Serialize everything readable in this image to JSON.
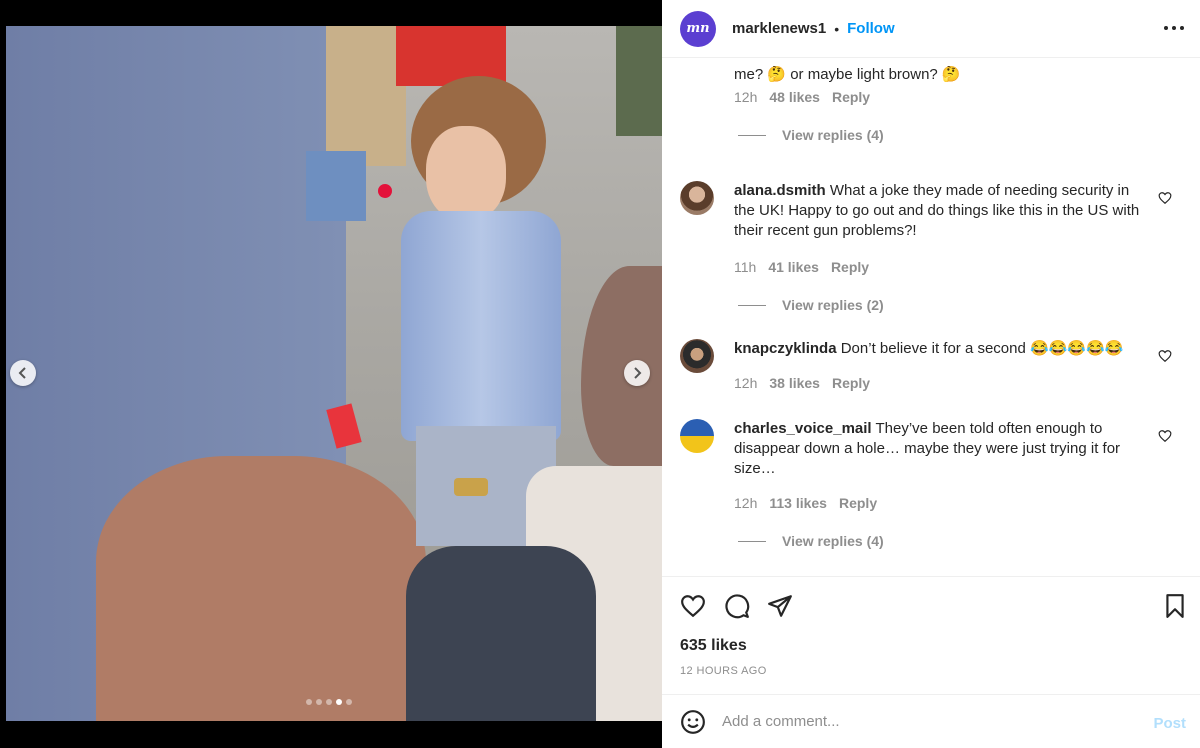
{
  "post": {
    "username": "marklenews1",
    "avatar_text": "mn",
    "follow_label": "Follow",
    "separator": "•"
  },
  "comments": [
    {
      "username": "",
      "text": "me? 🤔 or maybe light brown? 🤔",
      "time": "12h",
      "likes": "48 likes",
      "reply": "Reply",
      "view_replies": "View replies (4)"
    },
    {
      "username": "alana.dsmith",
      "text": "What a joke they made of needing security in the UK! Happy to go out and do things like this in the US with their recent gun problems?!",
      "time": "11h",
      "likes": "41 likes",
      "reply": "Reply",
      "view_replies": "View replies (2)"
    },
    {
      "username": "knapczyklinda",
      "text": "Don’t believe it for a second 😂😂😂😂😂",
      "time": "12h",
      "likes": "38 likes",
      "reply": "Reply"
    },
    {
      "username": "charles_voice_mail",
      "text": "They’ve been told often enough to disappear down a hole… maybe they were just trying it for size…",
      "time": "12h",
      "likes": "113 likes",
      "reply": "Reply",
      "view_replies": "View replies (4)"
    }
  ],
  "actions": {
    "icons": [
      "heart-icon",
      "comment-icon",
      "share-icon",
      "bookmark-icon"
    ],
    "likes_count": "635 likes",
    "time_ago": "12 HOURS AGO"
  },
  "add_comment": {
    "placeholder": "Add a comment...",
    "post_label": "Post"
  },
  "carousel": {
    "total": 5,
    "active_index": 3
  },
  "colors": {
    "accent": "#0095f6",
    "avatar": "#5b3fd1",
    "muted": "#8e8e8e",
    "post_disabled": "#b2dffc"
  }
}
